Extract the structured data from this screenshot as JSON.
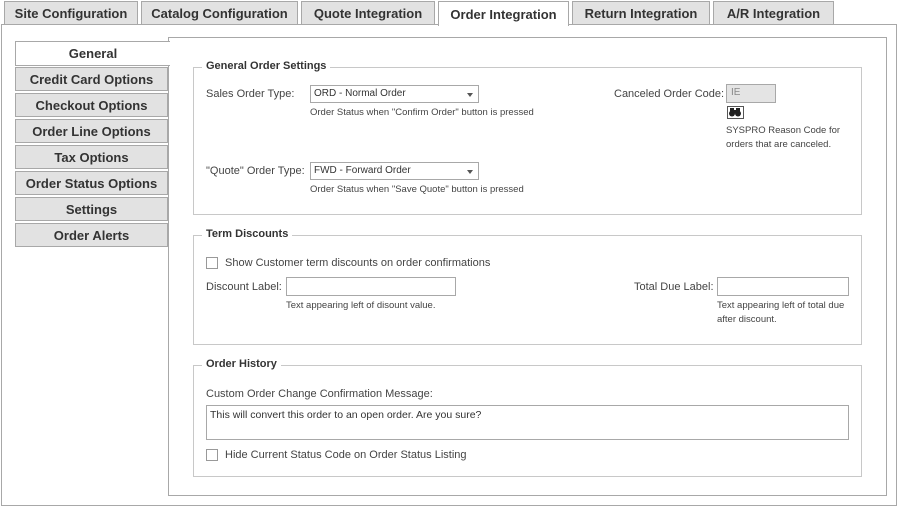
{
  "top_tabs": [
    {
      "label": "Site Configuration"
    },
    {
      "label": "Catalog Configuration"
    },
    {
      "label": "Quote Integration"
    },
    {
      "label": "Order Integration",
      "active": true
    },
    {
      "label": "Return Integration"
    },
    {
      "label": "A/R Integration"
    }
  ],
  "side_tabs": [
    {
      "label": "General",
      "active": true
    },
    {
      "label": "Credit Card Options"
    },
    {
      "label": "Checkout Options"
    },
    {
      "label": "Order Line Options"
    },
    {
      "label": "Tax Options"
    },
    {
      "label": "Order Status Options"
    },
    {
      "label": "Settings"
    },
    {
      "label": "Order Alerts"
    }
  ],
  "general_order_settings": {
    "legend": "General Order Settings",
    "sales_order_type_label": "Sales Order Type:",
    "sales_order_type_value": "ORD - Normal Order",
    "sales_order_type_hint": "Order Status when \"Confirm Order\" button is pressed",
    "quote_order_type_label": "\"Quote\" Order Type:",
    "quote_order_type_value": "FWD - Forward Order",
    "quote_order_type_hint": "Order Status when \"Save Quote\" button is pressed",
    "canceled_order_code_label": "Canceled Order Code:",
    "canceled_order_code_value": "IE",
    "canceled_order_code_hint": "SYSPRO Reason Code for orders that are canceled."
  },
  "term_discounts": {
    "legend": "Term Discounts",
    "show_discounts_label": "Show Customer term discounts on order confirmations",
    "show_discounts_checked": false,
    "discount_label_label": "Discount Label:",
    "discount_label_value": "",
    "discount_label_hint": "Text appearing left of disount value.",
    "total_due_label_label": "Total Due Label:",
    "total_due_label_value": "",
    "total_due_label_hint": "Text appearing left of total due after discount."
  },
  "order_history": {
    "legend": "Order History",
    "confirmation_message_label": "Custom Order Change Confirmation Message:",
    "confirmation_message_value": "This will convert this order to an open order. Are you sure?",
    "hide_status_code_label": "Hide Current Status Code on Order Status Listing",
    "hide_status_code_checked": false
  }
}
